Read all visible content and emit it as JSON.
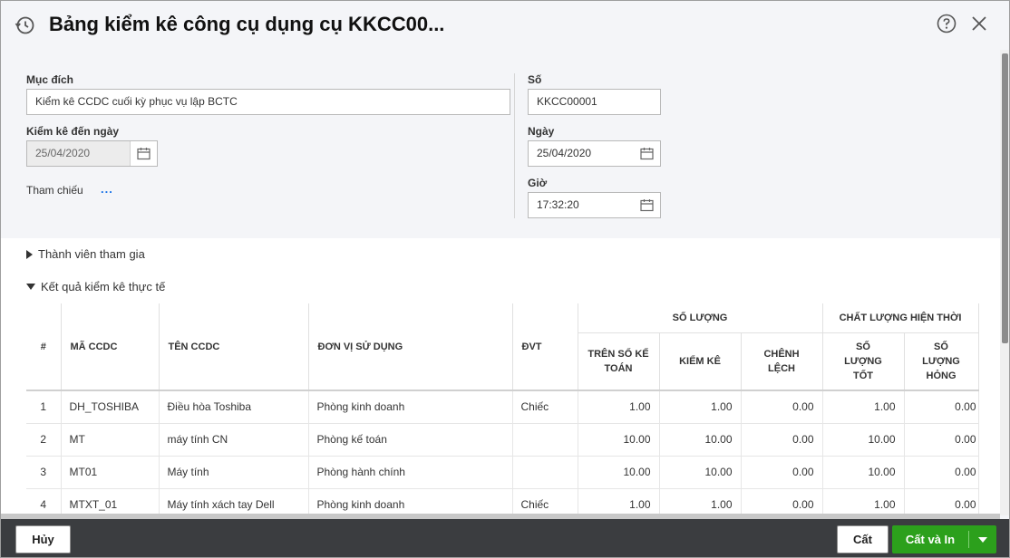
{
  "header": {
    "title": "Bảng kiểm kê công cụ dụng cụ KKCC00...",
    "history_icon": "history-icon",
    "help_icon": "help-icon",
    "close_icon": "close-icon"
  },
  "form": {
    "purpose_label": "Mục đích",
    "purpose_value": "Kiểm kê CCDC cuối kỳ phục vụ lập BCTC",
    "check_date_label": "Kiểm kê đến ngày",
    "check_date_value": "25/04/2020",
    "reference_label": "Tham chiếu",
    "reference_link": "...",
    "number_label": "Số",
    "number_value": "KKCC00001",
    "date_label": "Ngày",
    "date_value": "25/04/2020",
    "time_label": "Giờ",
    "time_value": "17:32:20"
  },
  "sections": {
    "members": "Thành viên tham gia",
    "results": "Kết quả kiểm kê thực tế"
  },
  "table": {
    "headers": {
      "no": "#",
      "code": "MÃ CCDC",
      "name": "TÊN CCDC",
      "unit": "ĐƠN VỊ SỬ DỤNG",
      "uom": "ĐVT",
      "quantity_group": "SỐ LƯỢNG",
      "quality_group": "CHẤT LƯỢNG HIỆN THỜI",
      "book": "TRÊN SỔ KẾ TOÁN",
      "counted": "KIỂM KÊ",
      "diff": "CHÊNH LỆCH",
      "good": "SỐ LƯỢNG TỐT",
      "broken": "SỐ LƯỢNG HỎNG"
    },
    "rows": [
      {
        "no": "1",
        "code": "DH_TOSHIBA",
        "name": "Điều hòa Toshiba",
        "unit": "Phòng kinh doanh",
        "uom": "Chiếc",
        "book": "1.00",
        "counted": "1.00",
        "diff": "0.00",
        "good": "1.00",
        "broken": "0.00"
      },
      {
        "no": "2",
        "code": "MT",
        "name": "máy tính CN",
        "unit": "Phòng kế toán",
        "uom": "",
        "book": "10.00",
        "counted": "10.00",
        "diff": "0.00",
        "good": "10.00",
        "broken": "0.00"
      },
      {
        "no": "3",
        "code": "MT01",
        "name": "Máy tính",
        "unit": "Phòng hành chính",
        "uom": "",
        "book": "10.00",
        "counted": "10.00",
        "diff": "0.00",
        "good": "10.00",
        "broken": "0.00"
      },
      {
        "no": "4",
        "code": "MTXT_01",
        "name": "Máy tính xách tay Dell",
        "unit": "Phòng kinh doanh",
        "uom": "Chiếc",
        "book": "1.00",
        "counted": "1.00",
        "diff": "0.00",
        "good": "1.00",
        "broken": "0.00"
      }
    ]
  },
  "footer": {
    "cancel": "Hủy",
    "save": "Cất",
    "save_print": "Cất và In"
  },
  "colors": {
    "accent": "#2ca01c",
    "footer_bg": "#3b3d40",
    "link": "#1a73e8"
  }
}
